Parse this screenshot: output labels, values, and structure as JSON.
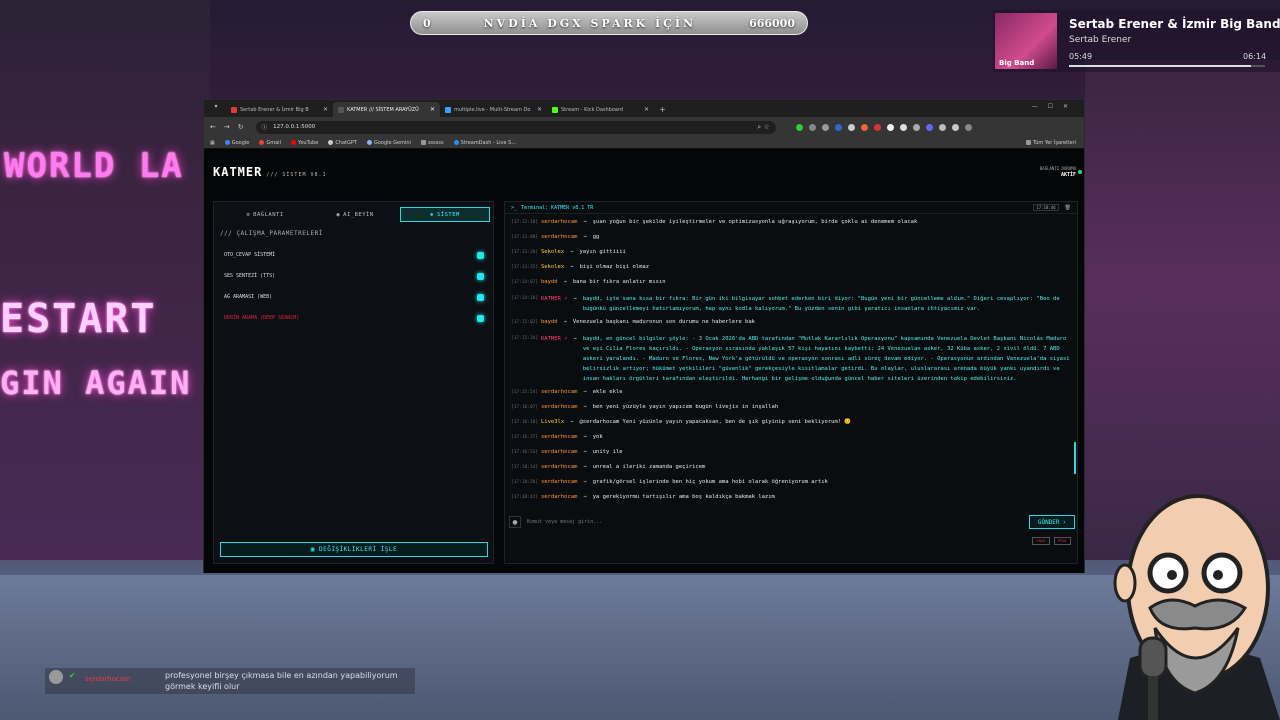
{
  "banner": {
    "left": "0",
    "title": "NVDİA DGX SPARK İÇİN",
    "right": "666000"
  },
  "now_playing": {
    "title": "Sertab Erener & İzmir Big Band - O",
    "artist": "Sertab Erener",
    "art_label": "Big Band",
    "elapsed": "05:49",
    "total": "06:14",
    "progress": 0.93
  },
  "browser": {
    "tabs": [
      {
        "label": "Sertab Erener & İzmir Big B",
        "color": "#e53935"
      },
      {
        "label": "KATMER /// SİSTEM ARAYÜZÜ",
        "color": "#333333"
      },
      {
        "label": "multiple.live - Multi-Stream Do",
        "color": "#3aa0ff"
      },
      {
        "label": "Stream - Kick Dashboard",
        "color": "#53fc18"
      }
    ],
    "url": "127.0.0.1:5000",
    "bookmarks": [
      {
        "label": "Google",
        "color": "#4285f4"
      },
      {
        "label": "Gmail",
        "color": "#ea4335"
      },
      {
        "label": "YouTube",
        "color": "#ff0000"
      },
      {
        "label": "ChatGPT",
        "color": "#cccccc"
      },
      {
        "label": "Google Gemini",
        "color": "#8ab4f8"
      },
      {
        "label": "ssssss",
        "color": "#999999"
      },
      {
        "label": "StreamDash - Live S...",
        "color": "#2b8cff"
      }
    ],
    "all_bookmarks": "Tüm Yer İşaretleri"
  },
  "app": {
    "logo": "KATMER",
    "version": "/// SİSTEM V8.1",
    "conn_label": "BAĞLANTI DURUMU",
    "conn_status": "AKTİF",
    "tabs": [
      "BAĞLANTI",
      "AI_BEYİN",
      "SİSTEM"
    ],
    "section": "/// ÇALIŞMA_PARAMETRELERİ",
    "params": [
      "OTO_CEVAP SİSTEMİ",
      "SES SENTEZİ (TTS)",
      "AĞ ARAMASI (WEB)",
      "DERİN ARAMA (DEEP SEARCH)"
    ],
    "save": "DEĞİŞİKLİKLERİ İŞLE",
    "terminal_title": "Terminal: KATMER v8.1 TR",
    "terminal_time": "17:18:46",
    "input_placeholder": "Komut veya mesaj girin...",
    "send": "GÖNDER",
    "mini": [
      "ONAY",
      "İPTAL"
    ],
    "messages": [
      {
        "ts": "[17:12:18]",
        "user": "serdarhocam",
        "color": "#ff9a3c",
        "text": "şuan yoğun bir şekilde iyileştirmeler ve optimizasyonla uğraşıyorum, birde çoklu ai denemem olacak",
        "bot": false
      },
      {
        "ts": "[17:13:08]",
        "user": "serdarhocam",
        "color": "#ff9a3c",
        "text": "gg",
        "bot": false
      },
      {
        "ts": "[17:13:28]",
        "user": "Sekolex",
        "color": "#ffd23c",
        "text": "yayın gittiiii",
        "bot": false
      },
      {
        "ts": "[17:13:35]",
        "user": "Sekolex",
        "color": "#ffd23c",
        "text": "bişi olmaz bişi olmaz",
        "bot": false
      },
      {
        "ts": "[17:14:07]",
        "user": "baydd",
        "color": "#ff9a3c",
        "text": "bana bir fıkra anlatır mısın",
        "bot": false
      },
      {
        "ts": "[17:14:18]",
        "user": "KATMER ⚡",
        "color": "#ff3c6a",
        "text": "baydd, işte sana kısa bir fıkra: Bir gün iki bilgisayar sohbet ederken biri diyor: \"Bugün yeni bir güncelleme aldım.\" Diğeri cevaplıyor: \"Ben de bugünkü güncellemeyi hatırlamıyorum, hep aynı kodla kalıyorum.\" Bu yüzden senin gibi yaratıcı insanlara ihtiyacımız var.",
        "bot": true
      },
      {
        "ts": "[17:15:02]",
        "user": "baydd",
        "color": "#ff9a3c",
        "text": "Venezuela başkanı maduronun son durumu ne haberlere bak",
        "bot": false
      },
      {
        "ts": "[17:15:34]",
        "user": "KATMER ⚡",
        "color": "#ff3c6a",
        "text": "baydd, en güncel bilgiler şöyle: - 3 Ocak 2026'da ABD tarafından \"Mutlak Kararlılık Operasyonu\" kapsamında Venezuela Devlet Başkanı Nicolás Maduro ve eşi Cilia Flores kaçırıldı. - Operasyon sırasında yaklaşık 57 kişi hayatını kaybetti; 24 Venezuelan asker, 32 Küba asker, 2 sivil öldü. 7 ABD askeri yaralandı. - Maduro ve Flores, New York'a götürüldü ve operasyon sonrası adli süreç devam ediyor. - Operasyonun ardından Venezuela'da siyasi belirsizlik artıyor; hükümet yetkilileri \"güvenlik\" gerekçesiyle kısıtlamalar getirdi. Bu olaylar, uluslararası arenada büyük yankı uyandırdı ve insan hakları örgütleri tarafından eleştirildi. Herhangi bir gelişme olduğunda güncel haber siteleri üzerinden takip edebilirsiniz.",
        "bot": true
      },
      {
        "ts": "[17:15:54]",
        "user": "serdarhocam",
        "color": "#ff9a3c",
        "text": "ekle ekle",
        "bot": false
      },
      {
        "ts": "[17:16:07]",
        "user": "serdarhocam",
        "color": "#ff9a3c",
        "text": "ben yeni yüzüyle yayın yapıcam bugün livejix in inşallah",
        "bot": false
      },
      {
        "ts": "[17:16:18]",
        "user": "Live3lx",
        "color": "#ffd23c",
        "text": "@serdarhocam Yeni yüzünle yayın yapacaksan, ben de şık giyinip seni bekliyorum! 😊",
        "bot": false
      },
      {
        "ts": "[17:16:37]",
        "user": "serdarhocam",
        "color": "#ff9a3c",
        "text": "yok",
        "bot": false
      },
      {
        "ts": "[17:16:53]",
        "user": "serdarhocam",
        "color": "#ff9a3c",
        "text": "unity ile",
        "bot": false
      },
      {
        "ts": "[17:18:14]",
        "user": "serdarhocam",
        "color": "#ff9a3c",
        "text": "unreal a ileriki zamanda geçiricem",
        "bot": false
      },
      {
        "ts": "[17:18:26]",
        "user": "serdarhocam",
        "color": "#ff9a3c",
        "text": "grafik/görsel işlerinde ben hiç yokum ama hobi olarak öğreniyorum artık",
        "bot": false
      },
      {
        "ts": "[17:18:42]",
        "user": "serdarhocam",
        "color": "#ff9a3c",
        "text": "ya gerekiyormu tartışılır ama boş kaldıkça bakmak lazım",
        "bot": false
      }
    ]
  },
  "chat_overlay": {
    "name": "serdarhocam",
    "text": "profesyonel birşey çıkmasa bile en azından yapabiliyorum görmek keyifli olur"
  },
  "background": {
    "sign1": "WORLD LA",
    "sign2": "ESTART",
    "sign3": "GIN AGAIN"
  }
}
